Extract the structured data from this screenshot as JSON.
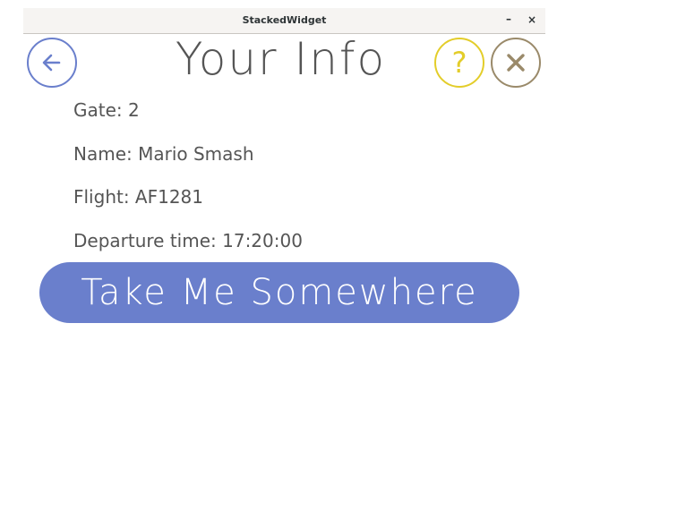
{
  "window": {
    "title": "StackedWidget",
    "minimize_label": "–",
    "close_label": "×"
  },
  "header": {
    "title": "Your Info",
    "back_icon": "arrow-left-icon",
    "help_icon": "question-mark-icon",
    "help_label": "?",
    "close_icon": "close-x-icon"
  },
  "info": {
    "gate": "Gate: 2",
    "name": "Name: Mario Smash",
    "flight": "Flight: AF1281",
    "departure": "Departure time: 17:20:00"
  },
  "action": {
    "button_label": "Take Me Somewhere"
  },
  "colors": {
    "accent_blue": "#6a7fcc",
    "help_yellow": "#e3cd2a",
    "close_khaki": "#9a8a6a",
    "text_gray": "#555555"
  }
}
